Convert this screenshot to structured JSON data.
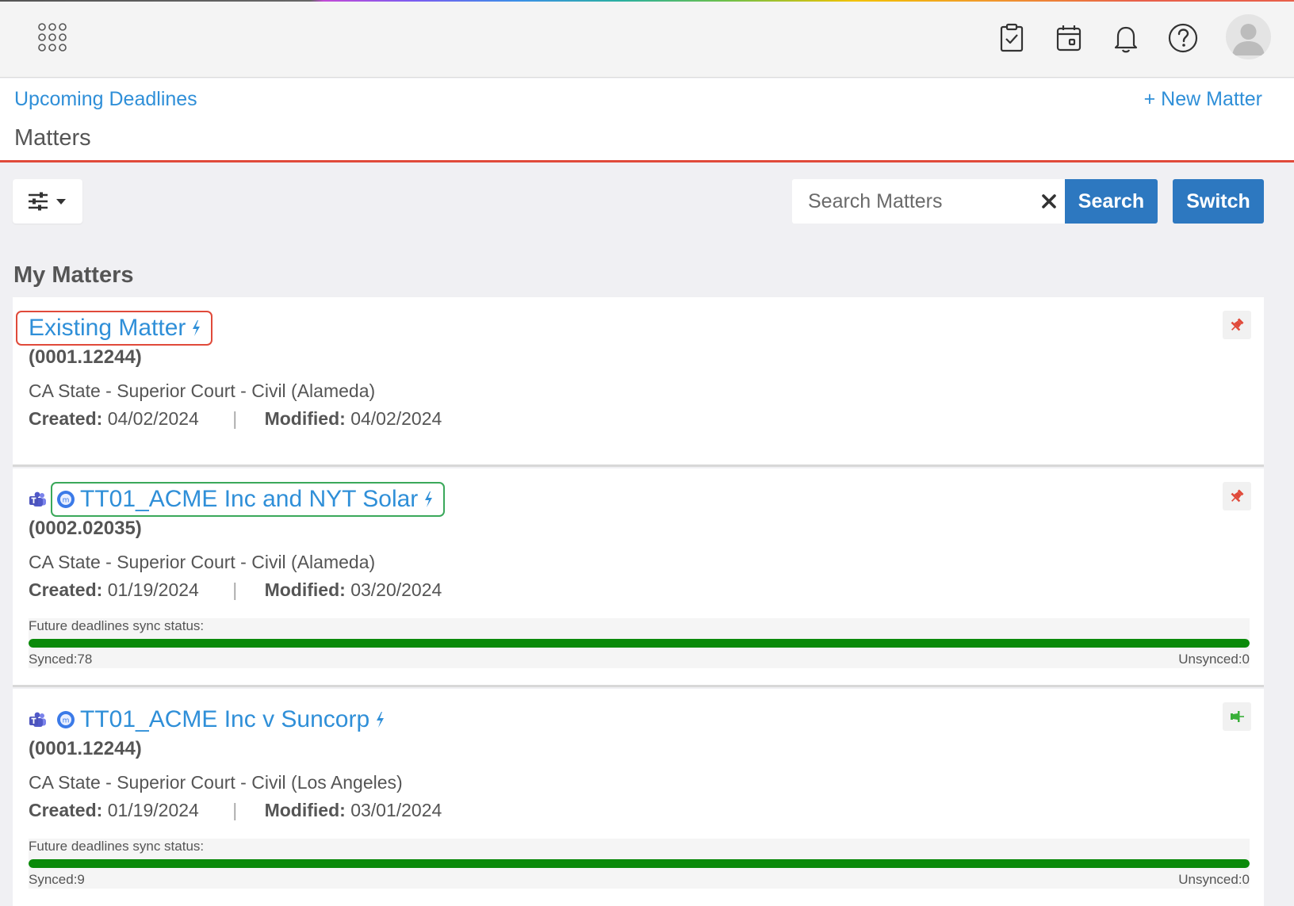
{
  "colors": {
    "link_blue": "#2f8fd8",
    "button_blue": "#2d78c0",
    "header_accent": "#e04a3a",
    "sync_green": "#0a8a0a",
    "pin_red": "#e04a3a",
    "pin_green": "#3ab03a"
  },
  "topbar": {
    "icons": [
      "apps-grid-icon",
      "tasks-clipboard-icon",
      "calendar-icon",
      "bell-icon",
      "help-icon",
      "user-avatar"
    ]
  },
  "header": {
    "upcoming_link": "Upcoming Deadlines",
    "new_matter_link": "+ New Matter",
    "title": "Matters"
  },
  "toolbar": {
    "search_placeholder": "Search Matters",
    "search_button": "Search",
    "switch_button": "Switch"
  },
  "section": {
    "title": "My Matters"
  },
  "matters": [
    {
      "title": "Existing Matter",
      "number": "(0001.12244)",
      "court": "CA State - Superior Court - Civil (Alameda)",
      "created_label": "Created:",
      "created": "04/02/2024",
      "separator": "|",
      "modified_label": "Modified:",
      "modified": "04/02/2024",
      "pin": "pinned-red"
    },
    {
      "title": "TT01_ACME Inc and NYT Solar",
      "number": "(0002.02035)",
      "court": "CA State - Superior Court - Civil (Alameda)",
      "created_label": "Created:",
      "created": "01/19/2024",
      "separator": "|",
      "modified_label": "Modified:",
      "modified": "03/20/2024",
      "pin": "pinned-red",
      "sync_label": "Future deadlines sync status:",
      "synced": "Synced:78",
      "unsynced": "Unsynced:0",
      "sync_fraction": 1.0
    },
    {
      "title": "TT01_ACME Inc v Suncorp",
      "number": "(0001.12244)",
      "court": "CA State - Superior Court - Civil (Los Angeles)",
      "created_label": "Created:",
      "created": "01/19/2024",
      "separator": "|",
      "modified_label": "Modified:",
      "modified": "03/01/2024",
      "pin": "unpinned-green",
      "sync_label": "Future deadlines sync status:",
      "synced": "Synced:9",
      "unsynced": "Unsynced:0",
      "sync_fraction": 1.0
    }
  ]
}
